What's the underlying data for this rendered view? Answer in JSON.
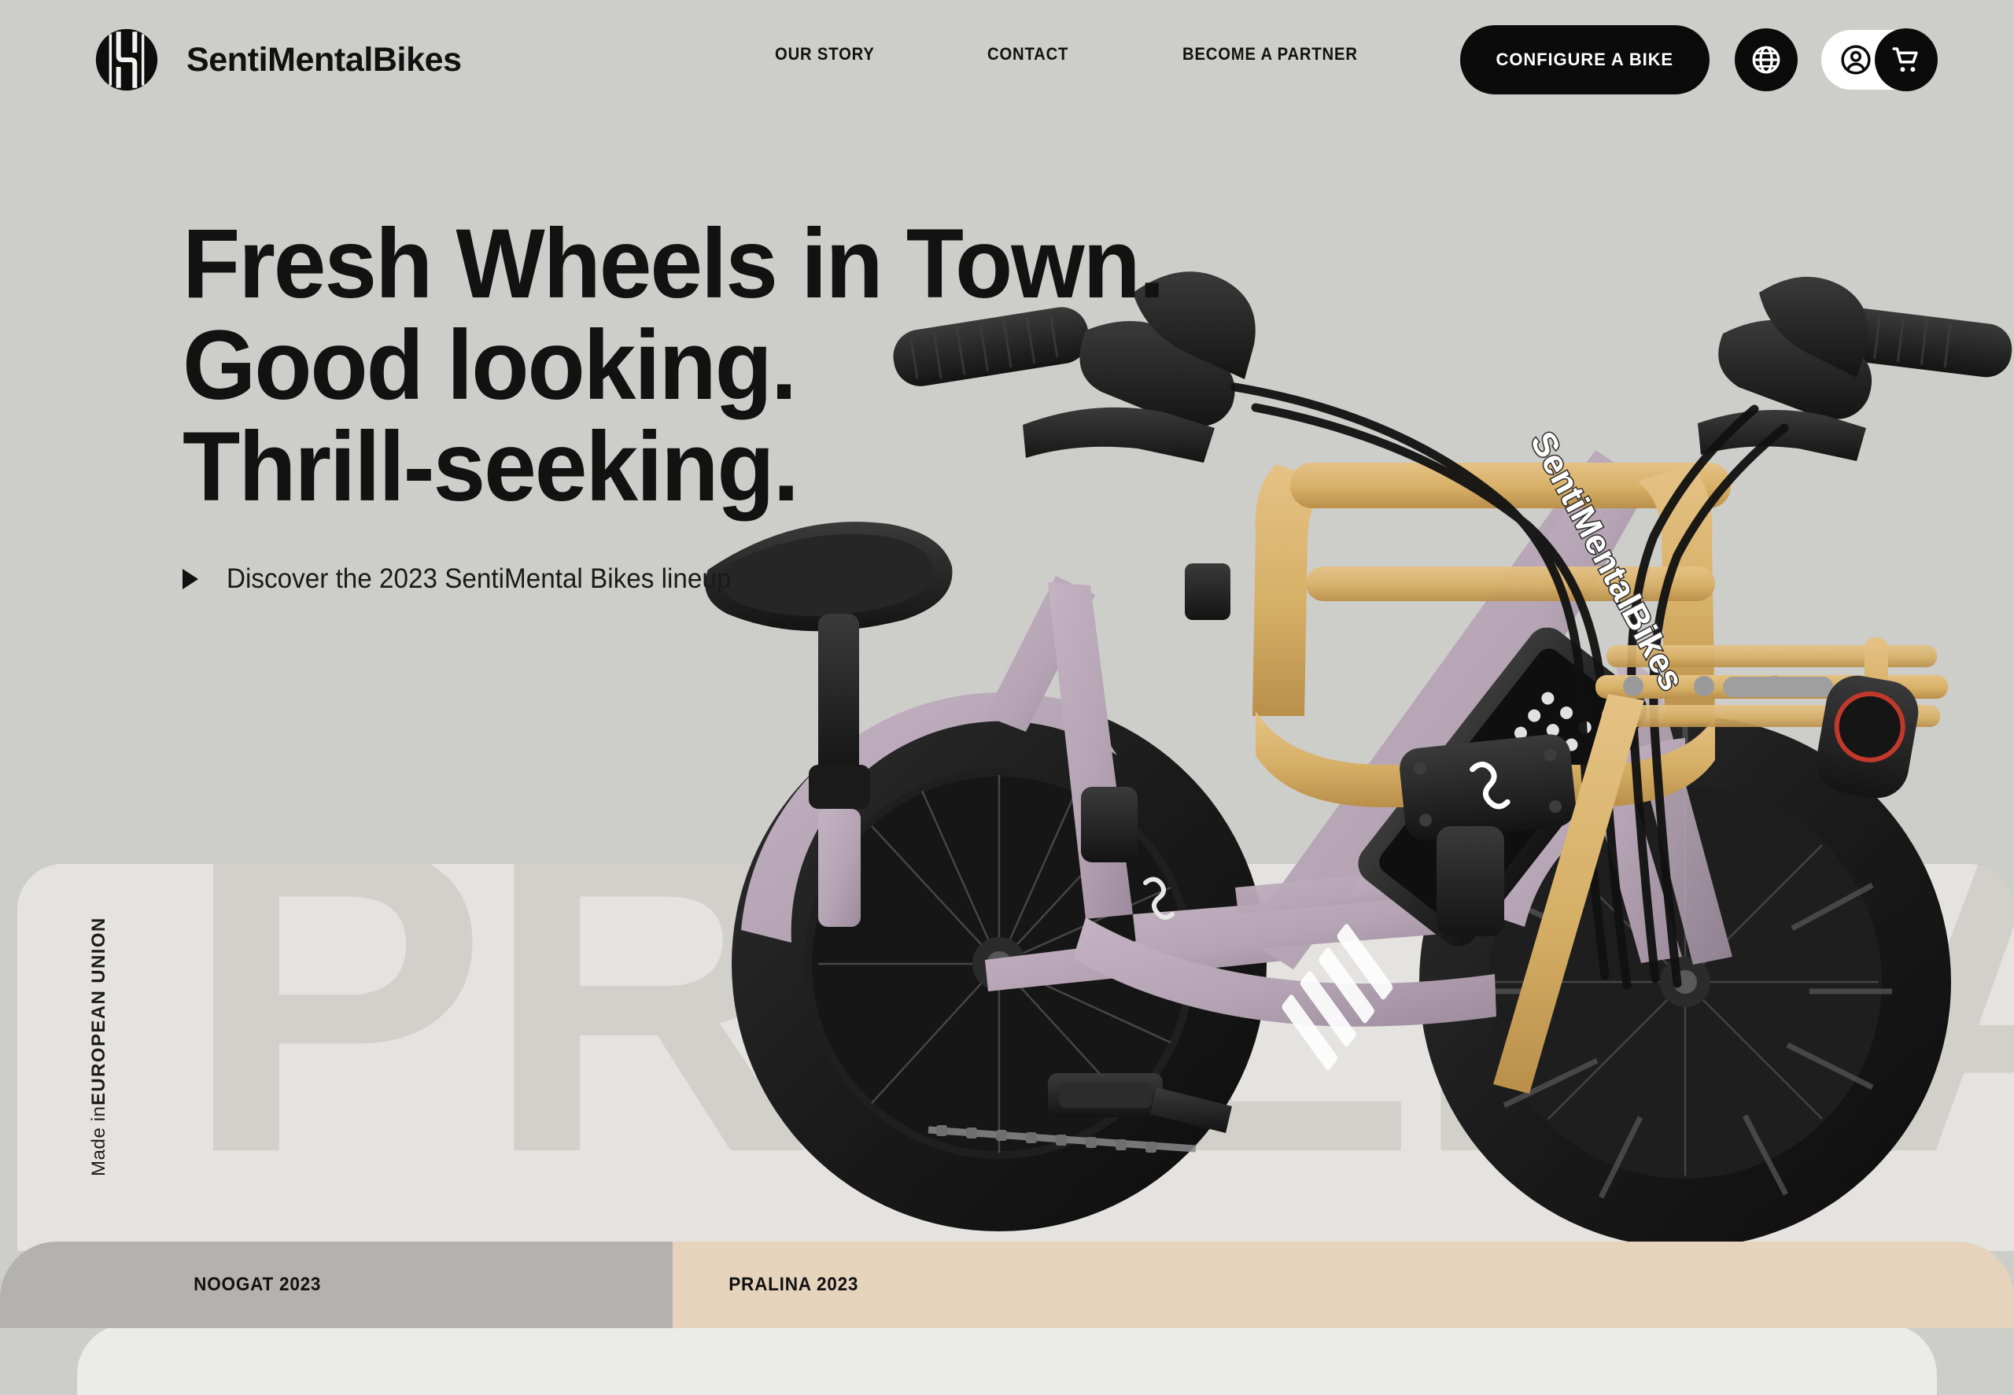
{
  "brand": {
    "name": "SentiMentalBikes",
    "logo_icon": "sentimentalbikes-monogram-icon"
  },
  "header": {
    "nav": [
      {
        "label": "OUR STORY",
        "name": "nav-our-story"
      },
      {
        "label": "CONTACT",
        "name": "nav-contact"
      },
      {
        "label": "BECOME A PARTNER",
        "name": "nav-become-a-partner"
      }
    ],
    "configure_label": "CONFIGURE A BIKE",
    "language_icon": "globe-icon",
    "account_icon": "user-account-icon",
    "cart_icon": "shopping-cart-icon"
  },
  "hero": {
    "headline_lines": [
      "Fresh Wheels in Town.",
      "Good looking.",
      "Thrill-seeking."
    ],
    "cta_text": "Discover the 2023 SentiMental Bikes lineup",
    "cta_icon": "play-triangle-icon"
  },
  "watermark": {
    "text": "PRALINA"
  },
  "made_in": {
    "prefix": "Made in ",
    "region": "EUROPEAN UNION"
  },
  "model_tabs": [
    {
      "label": "NOOGAT 2023",
      "name": "tab-noogat-2023",
      "active": false
    },
    {
      "label": "PRALINA 2023",
      "name": "tab-pralina-2023",
      "active": true
    }
  ],
  "bike": {
    "model_badge": "SentiMentalBikes",
    "frame_color": "#b9a8b8",
    "accent_color": "#d9b36b",
    "tire_color": "#1c1c1c"
  },
  "colors": {
    "page_background": "#cdcdc9",
    "panel_background": "#e4e3df",
    "watermark_fill": "#d1d0cb",
    "tab_inactive": "#b4b2af",
    "tab_active": "#e5d3bb",
    "ink": "#121212",
    "button_black": "#0b0b0b",
    "button_white": "#ffffff"
  }
}
